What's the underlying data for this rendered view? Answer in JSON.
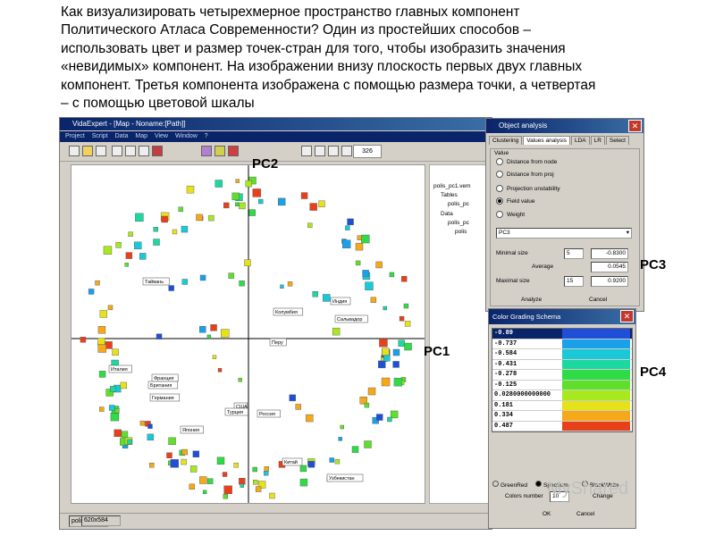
{
  "caption": {
    "lines": [
      "Как визуализировать четырехмерное пространство главных компонент",
      "Политического Атласа Современности? Один из простейших способов –",
      "использовать цвет и размер точек-стран для того, чтобы изобразить значения",
      "«невидимых» компонент. На изображении внизу плоскость первых двух главных",
      "компонент. Третья компонента изображена с помощью размера точки, а четвертая",
      "– с помощью цветовой шкалы"
    ]
  },
  "app": {
    "title": "VidaExpert - [Map - Noname:[Path]]",
    "menu": [
      "Project",
      "Script",
      "Data",
      "Map",
      "View",
      "Window",
      "?"
    ],
    "zoom": "326",
    "status": {
      "file": "polis_pc1",
      "size": "620x584"
    }
  },
  "tree": {
    "items": [
      "polis_pc1.vem",
      "Tables",
      "polis_pc",
      "Data",
      "polis_pc",
      "polis"
    ]
  },
  "map": {
    "country_labels": [
      "Тайвань",
      "Индия",
      "Колумбия",
      "Сальвадор",
      "Перу",
      "Италия",
      "Франция",
      "Британия",
      "Германия",
      "США",
      "Турция",
      "Россия",
      "Япония",
      "Китай",
      "Узбекистан"
    ]
  },
  "object_analysis": {
    "title": "Object analysis",
    "tabs": [
      "Clustering",
      "Values analysis",
      "LDA",
      "LR",
      "Select"
    ],
    "value_group": "Value",
    "options": [
      "Distance from node",
      "Distance from proj",
      "Projection unstability",
      "Field value",
      "Weight"
    ],
    "selected_option": "Field value",
    "field": "PC3",
    "minimal_size_label": "Minimal size",
    "minimal_size": "5",
    "minimal_value": "-0.8300",
    "average_label": "Average",
    "average_value": "0.0545",
    "maximal_size_label": "Maximal size",
    "maximal_size": "15",
    "maximal_value": "0.9200",
    "analyze": "Analyze",
    "cancel": "Cancel"
  },
  "color_grading": {
    "title": "Color Grading Schema",
    "rows": [
      {
        "value": "-0.89",
        "color": "#1f4fd8"
      },
      {
        "value": "-0.737",
        "color": "#1aa0e8"
      },
      {
        "value": "-0.584",
        "color": "#19c9d8"
      },
      {
        "value": "-0.431",
        "color": "#1bd8a0"
      },
      {
        "value": "-0.278",
        "color": "#2fdc46"
      },
      {
        "value": "-0.125",
        "color": "#5ee02a"
      },
      {
        "value": "0.0280000000000",
        "color": "#a8e81e"
      },
      {
        "value": "0.181",
        "color": "#e6e21a"
      },
      {
        "value": "0.334",
        "color": "#f5a818"
      },
      {
        "value": "0.487",
        "color": "#e8401a"
      }
    ],
    "options": [
      "GreenRed",
      "Spectrum",
      "BlackWhite"
    ],
    "colors_number_label": "Colors number",
    "colors_number": "10",
    "change": "Change",
    "ok": "OK",
    "cancel": "Cancel"
  },
  "pc_labels": {
    "pc1": "PC1",
    "pc2": "PC2",
    "pc3": "PC3",
    "pc4": "PC4"
  },
  "watermark": "MyShared"
}
